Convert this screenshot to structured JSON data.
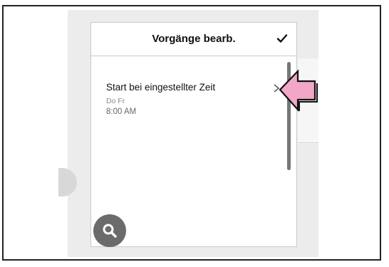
{
  "panel": {
    "title": "Vorgänge bearb.",
    "item": {
      "title": "Start bei eingestellter Zeit",
      "days": "Do Fr",
      "time": "8:00 AM"
    }
  },
  "icons": {
    "confirm": "check-icon",
    "open": "chevron-right-icon",
    "search": "search-icon",
    "pointer": "callout-arrow-icon"
  },
  "colors": {
    "arrow_fill": "#f2a7c8",
    "fab": "#6b6b6b"
  }
}
